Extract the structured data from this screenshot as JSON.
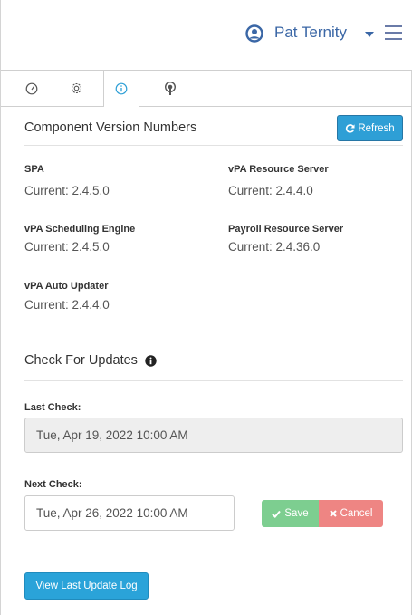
{
  "header": {
    "user_name": "Pat Ternity",
    "icons": {
      "user": "user-circle-icon",
      "caret": "caret-down-icon",
      "menu": "hamburger-menu-icon"
    }
  },
  "tabs": [
    {
      "icon": "speedometer-icon",
      "active": false
    },
    {
      "icon": "gear-icon",
      "active": false
    },
    {
      "icon": "info-icon",
      "active": true
    },
    {
      "icon": "broadcast-icon",
      "active": false
    }
  ],
  "versions": {
    "title": "Component Version Numbers",
    "refresh_label": "Refresh",
    "components": [
      {
        "name": "SPA",
        "current": "Current: 2.4.5.0"
      },
      {
        "name": "vPA Resource Server",
        "current": "Current: 2.4.4.0"
      },
      {
        "name": "vPA Scheduling Engine",
        "current": "Current: 2.4.5.0"
      },
      {
        "name": "Payroll Resource Server",
        "current": "Current: 2.4.36.0"
      },
      {
        "name": "vPA Auto Updater",
        "current": "Current: 2.4.4.0"
      }
    ]
  },
  "updates": {
    "title": "Check For Updates",
    "last_check_label": "Last Check:",
    "last_check_value": "Tue, Apr 19, 2022 10:00 AM",
    "next_check_label": "Next Check:",
    "next_check_value": "Tue, Apr 26, 2022 10:00 AM",
    "save_label": "Save",
    "cancel_label": "Cancel",
    "view_log_label": "View Last Update Log"
  },
  "colors": {
    "brand_blue": "#3b67a6",
    "info_blue": "#2e9fd6",
    "save_green": "#7dce90",
    "cancel_red": "#ee8583"
  }
}
